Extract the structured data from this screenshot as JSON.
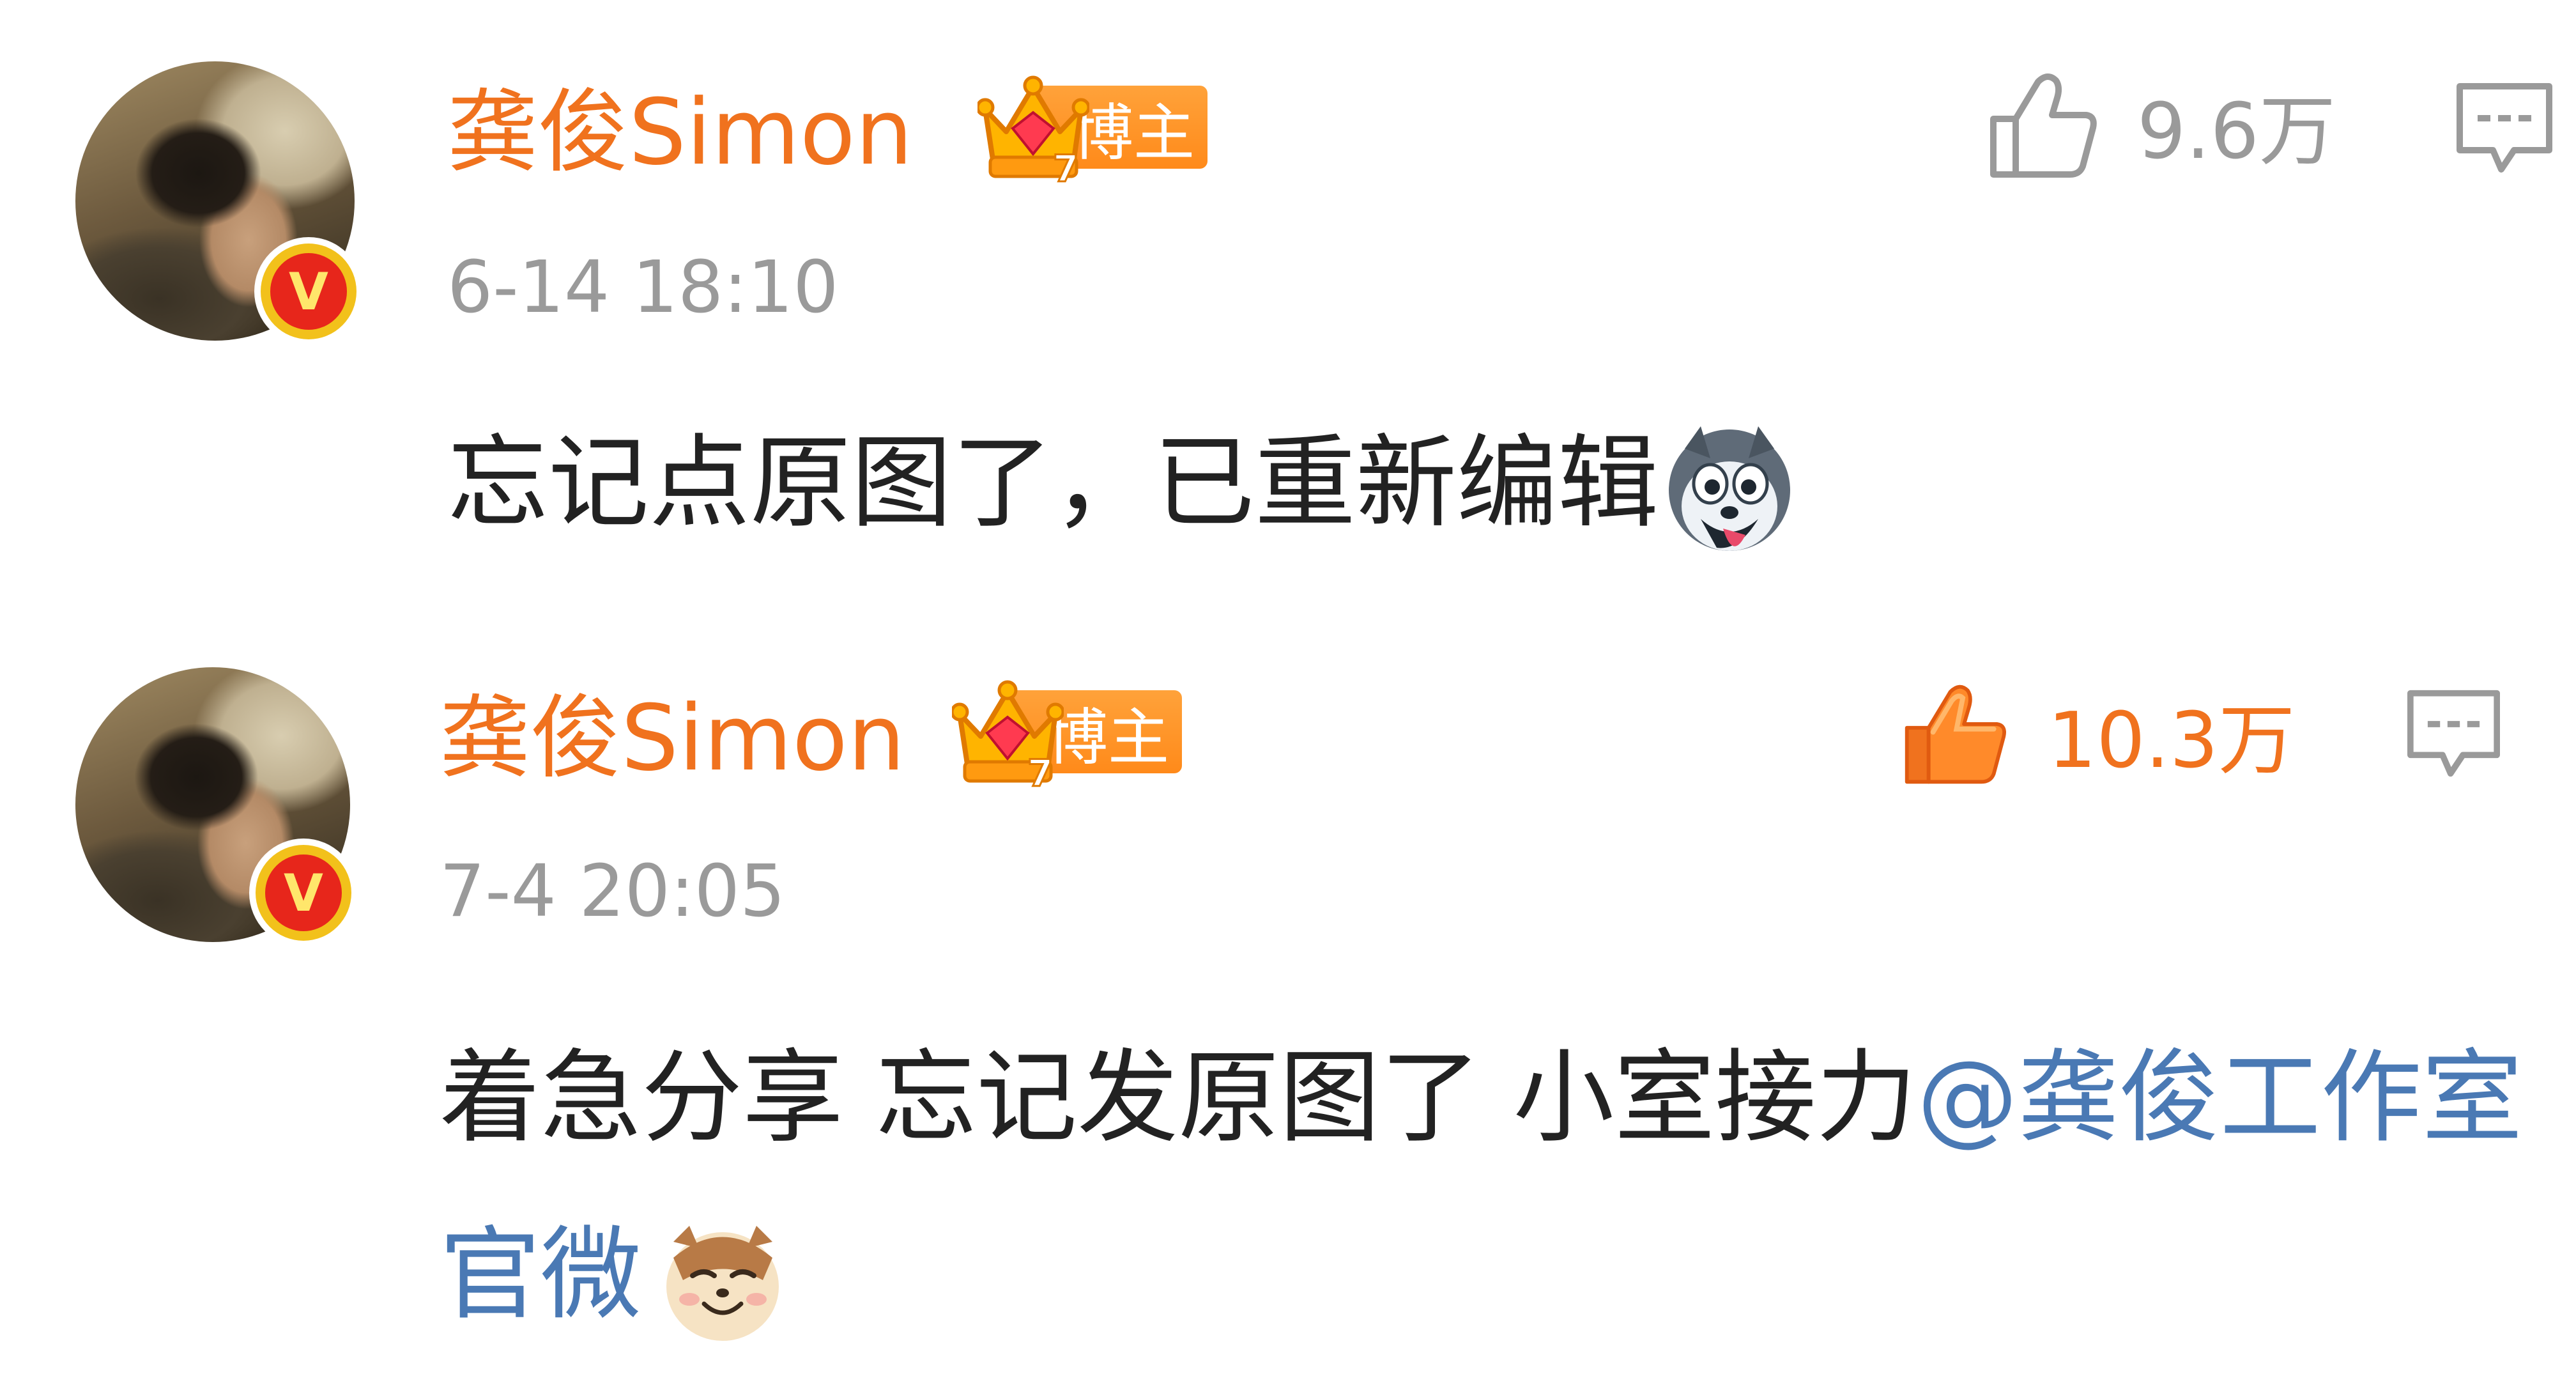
{
  "comments": [
    {
      "username": "龚俊Simon",
      "badge_label": "博主",
      "badge_level": "7",
      "timestamp": "6-14 18:10",
      "text": "忘记点原图了，已重新编辑",
      "emoji_name": "husky-emoji",
      "like_count": "9.6万",
      "liked": false
    },
    {
      "username": "龚俊Simon",
      "badge_label": "博主",
      "badge_level": "7",
      "timestamp": "7-4 20:05",
      "text": "着急分享 忘记发原图了 小室接力",
      "mention": "@龚俊工作室官微",
      "emoji_name": "hamster-emoji",
      "like_count": "10.3万",
      "liked": true
    }
  ],
  "colors": {
    "username": "#f0721e",
    "timestamp": "#9a9a9a",
    "text": "#222222",
    "mention": "#4a79b4",
    "like_active": "#f0721e",
    "like_inactive": "#9a9a9a",
    "badge_orange": "#ff8a1a",
    "verified_red": "#e7261b",
    "verified_gold": "#f2c11b"
  },
  "icons": {
    "verified": "V",
    "like": "thumbs-up-icon",
    "reply": "comment-bubble-icon"
  }
}
